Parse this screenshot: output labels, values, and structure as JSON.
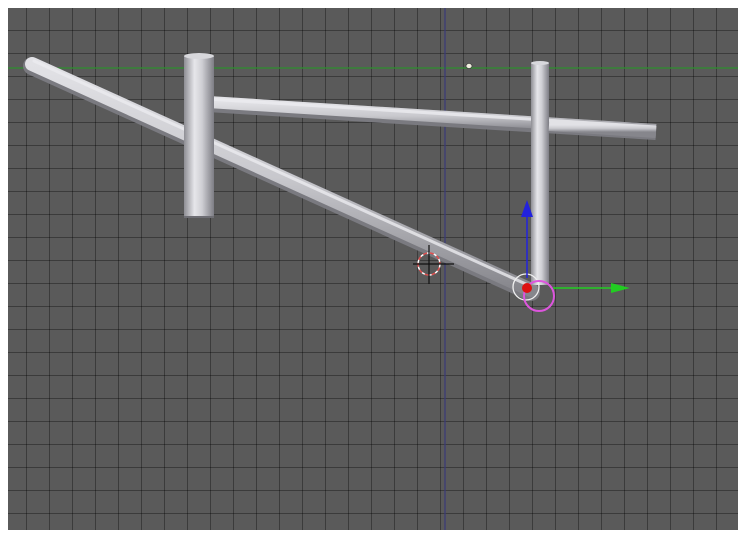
{
  "viewport": {
    "view": "3D viewport",
    "grid": true,
    "colors": {
      "background": "#5a5a5a",
      "grid_line": "#474747",
      "x_axis_line": "#2f8f2f",
      "y_axis_line": "#3a3a78",
      "tube": "#c4c4c8",
      "tube_shadow": "#8c8c92",
      "cursor_ring": "#e05050",
      "gizmo_x": "#22cc22",
      "gizmo_z": "#2222dd",
      "pivot": "#dd1111",
      "selection_ring": "#dd55dd"
    },
    "icons": {
      "cursor": "3d-cursor-icon",
      "gizmo": "transform-gizmo-icon",
      "pivot": "object-origin-icon",
      "lamp": "lamp-icon"
    }
  }
}
